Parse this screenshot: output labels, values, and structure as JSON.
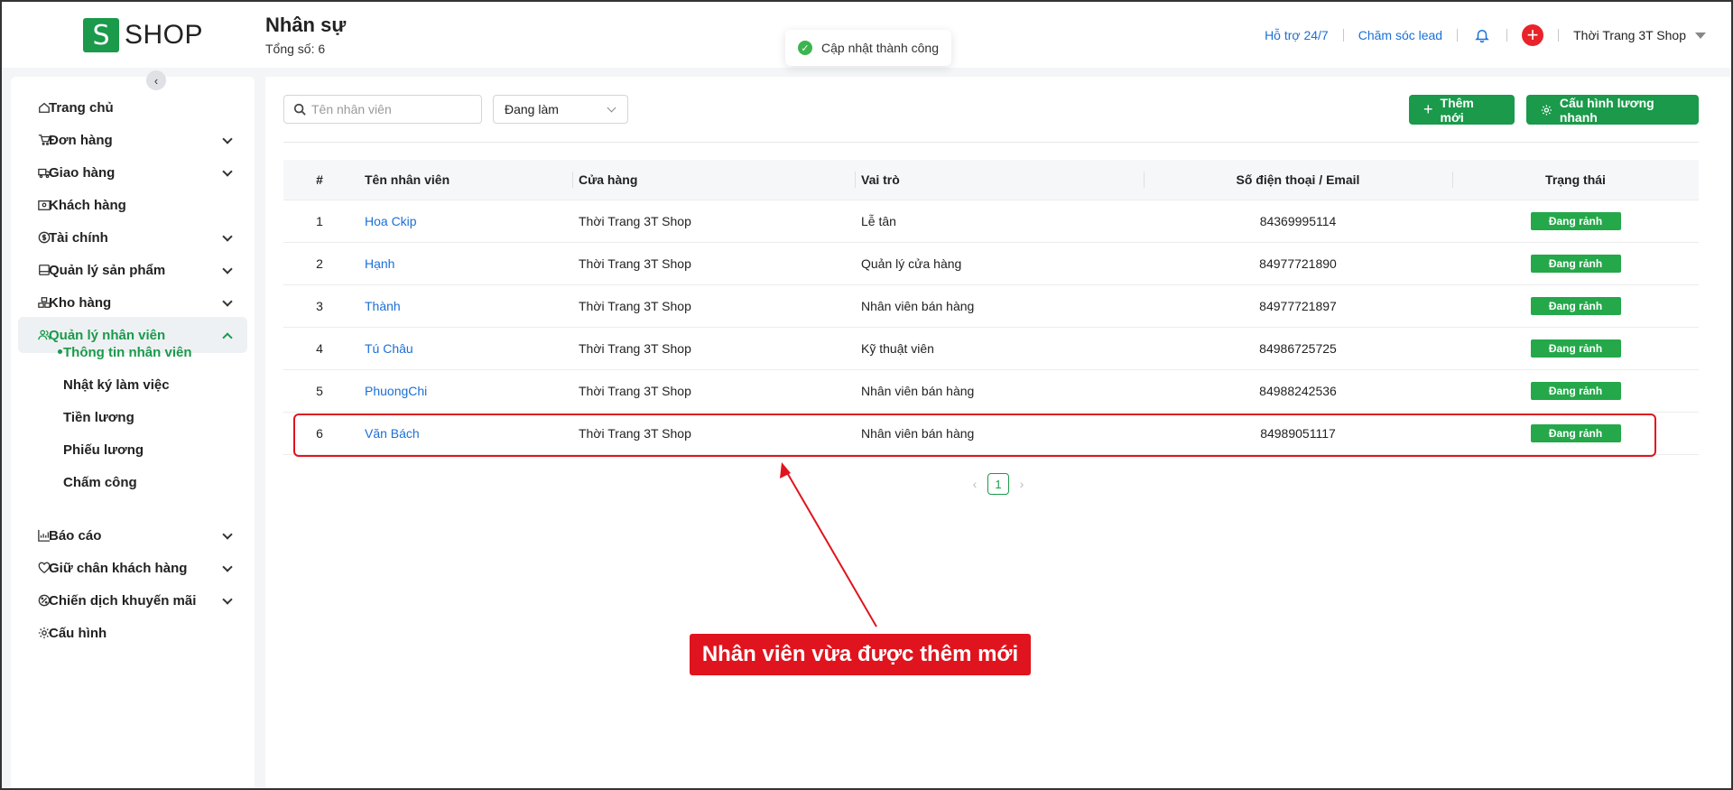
{
  "logo": {
    "mark": "S",
    "text": "SHOP"
  },
  "header": {
    "title": "Nhân sự",
    "subtitle": "Tổng số: 6",
    "links": [
      "Hỗ trợ 24/7",
      "Chăm sóc lead"
    ],
    "shop_name": "Thời Trang 3T Shop",
    "icons": {
      "notification": "bell-icon",
      "add": "plus-circle-icon",
      "dropdown": "caret-down-icon"
    }
  },
  "toast": {
    "text": "Cập nhật thành công",
    "icon": "check-circle-icon"
  },
  "sidebar": {
    "items": [
      {
        "label": "Trang chủ",
        "icon": "home-icon",
        "expandable": false
      },
      {
        "label": "Đơn hàng",
        "icon": "cart-icon",
        "expandable": true
      },
      {
        "label": "Giao hàng",
        "icon": "truck-icon",
        "expandable": true
      },
      {
        "label": "Khách hàng",
        "icon": "contact-card-icon",
        "expandable": false
      },
      {
        "label": "Tài chính",
        "icon": "dollar-circle-icon",
        "expandable": true
      },
      {
        "label": "Quản lý sản phẩm",
        "icon": "box-icon",
        "expandable": true
      },
      {
        "label": "Kho hàng",
        "icon": "warehouse-icon",
        "expandable": true
      },
      {
        "label": "Quản lý nhân viên",
        "icon": "users-icon",
        "expandable": true,
        "active": true
      },
      {
        "label": "Báo cáo",
        "icon": "chart-icon",
        "expandable": true
      },
      {
        "label": "Giữ chân khách hàng",
        "icon": "heart-icon",
        "expandable": true
      },
      {
        "label": "Chiến dịch khuyến mãi",
        "icon": "discount-icon",
        "expandable": true
      },
      {
        "label": "Cấu hình",
        "icon": "gear-icon",
        "expandable": false
      }
    ],
    "subitems": [
      {
        "label": "Thông tin nhân viên",
        "active": true
      },
      {
        "label": "Nhật ký làm việc"
      },
      {
        "label": "Tiền lương"
      },
      {
        "label": "Phiếu lương"
      },
      {
        "label": "Chấm công"
      }
    ]
  },
  "toolbar": {
    "search_placeholder": "Tên nhân viên",
    "status_filter": "Đang làm",
    "add_label": "Thêm mới",
    "config_label": "Cấu hình lương nhanh"
  },
  "table": {
    "columns": [
      "#",
      "Tên nhân viên",
      "Cửa hàng",
      "Vai trò",
      "Số điện thoại / Email",
      "Trạng thái"
    ],
    "rows": [
      {
        "no": "1",
        "name": "Hoa Ckip",
        "store": "Thời Trang 3T Shop",
        "role": "Lễ tân",
        "contact": "84369995114",
        "status": "Đang rảnh"
      },
      {
        "no": "2",
        "name": "Hạnh",
        "store": "Thời Trang 3T Shop",
        "role": "Quản lý cửa hàng",
        "contact": "84977721890",
        "status": "Đang rảnh"
      },
      {
        "no": "3",
        "name": "Thành",
        "store": "Thời Trang 3T Shop",
        "role": "Nhân viên bán hàng",
        "contact": "84977721897",
        "status": "Đang rảnh"
      },
      {
        "no": "4",
        "name": "Tú Châu",
        "store": "Thời Trang 3T Shop",
        "role": "Kỹ thuật viên",
        "contact": "84986725725",
        "status": "Đang rảnh"
      },
      {
        "no": "5",
        "name": "PhuongChi",
        "store": "Thời Trang 3T Shop",
        "role": "Nhân viên bán hàng",
        "contact": "84988242536",
        "status": "Đang rảnh"
      },
      {
        "no": "6",
        "name": "Văn Bách",
        "store": "Thời Trang 3T Shop",
        "role": "Nhân viên bán hàng",
        "contact": "84989051117",
        "status": "Đang rảnh"
      }
    ]
  },
  "pagination": {
    "current": "1"
  },
  "annotation": {
    "text": "Nhân viên vừa được thêm mới"
  },
  "colors": {
    "brand": "#1a9a4a",
    "link": "#1b6fd6",
    "annotation": "#e0141e",
    "status": "#24a84a"
  }
}
